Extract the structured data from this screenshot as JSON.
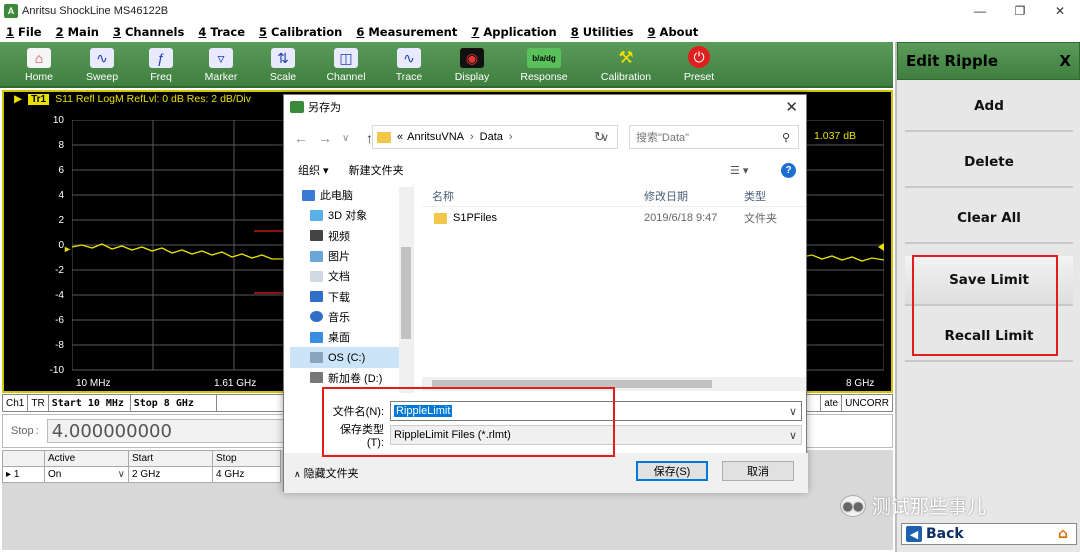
{
  "window": {
    "title": "Anritsu ShockLine MS46122B"
  },
  "menu": [
    {
      "num": "1",
      "label": "File"
    },
    {
      "num": "2",
      "label": "Main"
    },
    {
      "num": "3",
      "label": "Channels"
    },
    {
      "num": "4",
      "label": "Trace"
    },
    {
      "num": "5",
      "label": "Calibration"
    },
    {
      "num": "6",
      "label": "Measurement"
    },
    {
      "num": "7",
      "label": "Application"
    },
    {
      "num": "8",
      "label": "Utilities"
    },
    {
      "num": "9",
      "label": "About"
    }
  ],
  "toolbar": [
    {
      "label": "Home",
      "icon": "home-icon"
    },
    {
      "label": "Sweep",
      "icon": "sweep-icon"
    },
    {
      "label": "Freq",
      "icon": "freq-icon"
    },
    {
      "label": "Marker",
      "icon": "marker-icon"
    },
    {
      "label": "Scale",
      "icon": "scale-icon"
    },
    {
      "label": "Channel",
      "icon": "channel-icon"
    },
    {
      "label": "Trace",
      "icon": "trace-icon"
    },
    {
      "label": "Display",
      "icon": "display-icon"
    },
    {
      "label": "Response",
      "icon": "response-icon",
      "glyph": "b/a/dg"
    },
    {
      "label": "Calibration",
      "icon": "calibration-icon"
    },
    {
      "label": "Preset",
      "icon": "preset-icon"
    }
  ],
  "right_panel": {
    "title": "Edit Ripple",
    "close": "X",
    "buttons": [
      "Add",
      "Delete",
      "Clear All",
      "Save Limit",
      "Recall Limit"
    ],
    "back": "Back"
  },
  "chart": {
    "trace_tag": "Tr1",
    "trace_info": "S11 Refl LogM RefLvl: 0  dB Res: 2  dB/Div",
    "y_ticks": [
      "10",
      "8",
      "6",
      "4",
      "2",
      "0",
      "-2",
      "-4",
      "-6",
      "-8",
      "-10"
    ],
    "x_ticks": [
      "10 MHz",
      "1.61 GHz",
      "8 GHz"
    ],
    "marker_readout": "1.037 dB"
  },
  "status": {
    "ch": "Ch1",
    "tr": "TR",
    "start": "Start 10 MHz",
    "stop": "Stop 8 GHz",
    "i_frag": "I",
    "rate": "ate",
    "cal": "UNCORR"
  },
  "stop_field": {
    "label": "Stop",
    "value": "4.000000000"
  },
  "ripple_table": {
    "headers": [
      "Active",
      "Start",
      "Stop"
    ],
    "rows": [
      {
        "index": "1",
        "active": "On",
        "start": "2 GHz",
        "stop": "4 GHz"
      }
    ]
  },
  "dialog": {
    "title": "另存为",
    "path": [
      "«",
      "AnritsuVNA",
      "Data"
    ],
    "search_placeholder": "搜索\"Data\"",
    "organize": "组织 ▾",
    "new_folder": "新建文件夹",
    "nav_items": [
      {
        "label": "此电脑",
        "icon": "computer-icon"
      },
      {
        "label": "3D 对象",
        "icon": "3d-objects-icon"
      },
      {
        "label": "视频",
        "icon": "video-icon"
      },
      {
        "label": "图片",
        "icon": "pictures-icon"
      },
      {
        "label": "文档",
        "icon": "documents-icon"
      },
      {
        "label": "下载",
        "icon": "download-icon"
      },
      {
        "label": "音乐",
        "icon": "music-icon"
      },
      {
        "label": "桌面",
        "icon": "desktop-icon"
      },
      {
        "label": "OS (C:)",
        "icon": "drive-icon"
      },
      {
        "label": "新加卷 (D:)",
        "icon": "drive-icon"
      }
    ],
    "columns": [
      "名称",
      "修改日期",
      "类型"
    ],
    "files": [
      {
        "name": "S1PFiles",
        "date": "2019/6/18 9:47",
        "type": "文件夹"
      }
    ],
    "filename_label": "文件名(N):",
    "filename_value": "RippleLimit",
    "filetype_label": "保存类型(T):",
    "filetype_value": "RippleLimit Files (*.rlmt)",
    "hide_folders": "隐藏文件夹",
    "save": "保存(S)",
    "cancel": "取消"
  },
  "watermark": "测试那些事儿",
  "colors": {
    "accent_green": "#4a8c4a",
    "trace_yellow": "#e8e000",
    "limit_red": "#e21d1d"
  }
}
